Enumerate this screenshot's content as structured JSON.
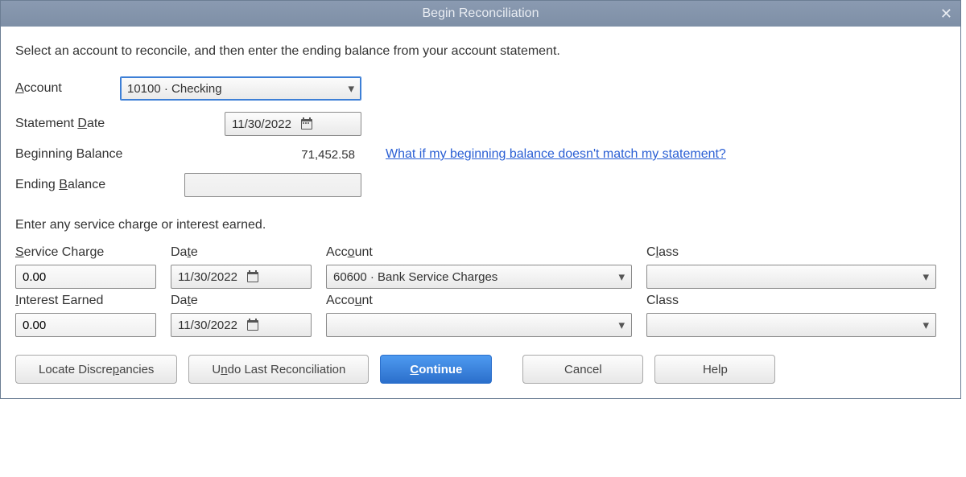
{
  "window": {
    "title": "Begin Reconciliation"
  },
  "instructions": "Select an account to reconcile, and then enter the ending balance from your account statement.",
  "labels": {
    "account": "Account",
    "statement_date": "Statement Date",
    "beginning_balance": "Beginning Balance",
    "ending_balance": "Ending Balance",
    "service_charge": "Service Charge",
    "interest_earned": "Interest Earned",
    "date": "Date",
    "account2": "Account",
    "class": "Class"
  },
  "fields": {
    "account_selected": "10100 · Checking",
    "statement_date": "11/30/2022",
    "beginning_balance": "71,452.58",
    "ending_balance": "",
    "service_charge_amount": "0.00",
    "service_charge_date": "11/30/2022",
    "service_charge_account": "60600 · Bank Service Charges",
    "service_charge_class": "",
    "interest_amount": "0.00",
    "interest_date": "11/30/2022",
    "interest_account": "",
    "interest_class": ""
  },
  "link": {
    "beginning_balance_help": "What if my beginning balance doesn't match my statement?"
  },
  "section_head": "Enter any service charge or interest earned.",
  "buttons": {
    "locate": "Locate Discrepancies",
    "undo": "Undo Last Reconciliation",
    "continue": "Continue",
    "cancel": "Cancel",
    "help": "Help"
  }
}
